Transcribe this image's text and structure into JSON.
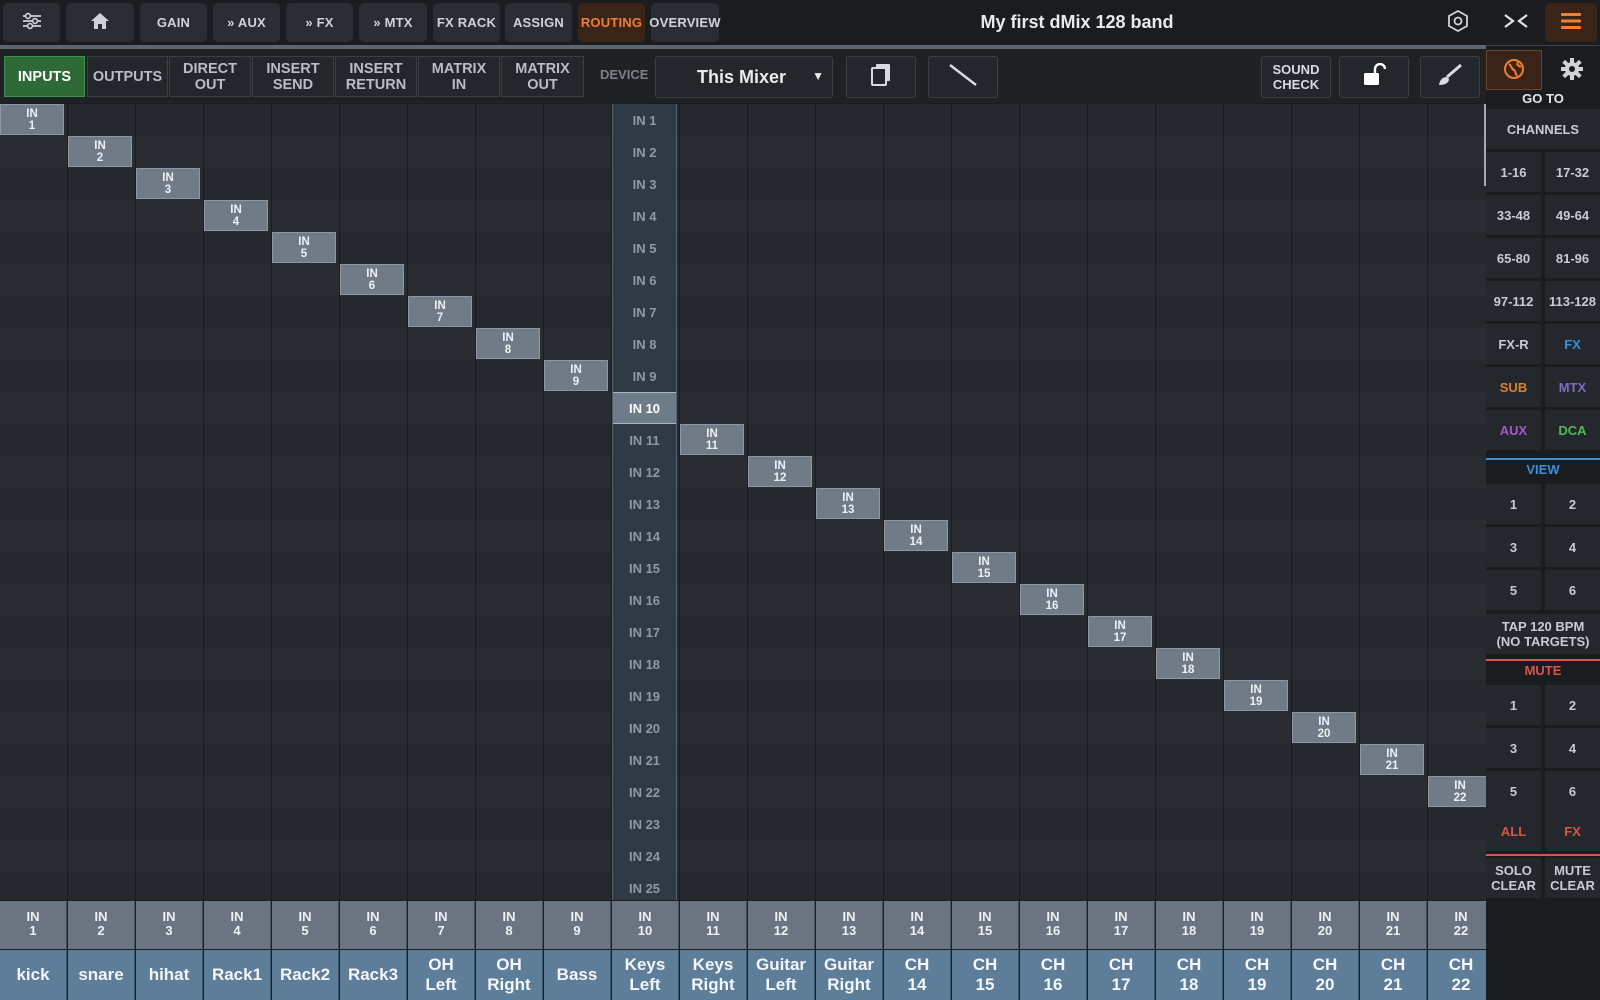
{
  "topbar": {
    "buttons": [
      {
        "id": "mixer",
        "label": "",
        "icon": "sliders-icon"
      },
      {
        "id": "home",
        "label": "",
        "icon": "home-icon"
      },
      {
        "id": "gain",
        "label": "GAIN"
      },
      {
        "id": "aux",
        "label": "» AUX"
      },
      {
        "id": "fx",
        "label": "» FX"
      },
      {
        "id": "mtx",
        "label": "» MTX"
      },
      {
        "id": "fxrack",
        "label": "FX RACK"
      },
      {
        "id": "assign",
        "label": "ASSIGN"
      },
      {
        "id": "routing",
        "label": "ROUTING",
        "active": true
      },
      {
        "id": "overview",
        "label": "OVERVIEW"
      }
    ],
    "title": "My first dMix 128 band"
  },
  "toolbar": {
    "tabs": [
      {
        "label": "INPUTS",
        "active": true
      },
      {
        "label": "OUTPUTS"
      },
      {
        "label": "DIRECT\nOUT"
      },
      {
        "label": "INSERT\nSEND"
      },
      {
        "label": "INSERT\nRETURN"
      },
      {
        "label": "MATRIX\nIN"
      },
      {
        "label": "MATRIX\nOUT"
      }
    ],
    "device_label": "DEVICE",
    "device_value": "This Mixer",
    "soundcheck": "SOUND\nCHECK"
  },
  "sources": [
    "IN 1",
    "IN 2",
    "IN 3",
    "IN 4",
    "IN 5",
    "IN 6",
    "IN 7",
    "IN 8",
    "IN 9",
    "IN 10",
    "IN 11",
    "IN 12",
    "IN 13",
    "IN 14",
    "IN 15",
    "IN 16",
    "IN 17",
    "IN 18",
    "IN 19",
    "IN 20",
    "IN 21",
    "IN 22",
    "IN 23",
    "IN 24",
    "IN 25"
  ],
  "selected_source": "IN 10",
  "channels": [
    {
      "num": "IN\n1",
      "name": "kick",
      "patch": "IN\n1"
    },
    {
      "num": "IN\n2",
      "name": "snare",
      "patch": "IN\n2"
    },
    {
      "num": "IN\n3",
      "name": "hihat",
      "patch": "IN\n3"
    },
    {
      "num": "IN\n4",
      "name": "Rack1",
      "patch": "IN\n4"
    },
    {
      "num": "IN\n5",
      "name": "Rack2",
      "patch": "IN\n5"
    },
    {
      "num": "IN\n6",
      "name": "Rack3",
      "patch": "IN\n6"
    },
    {
      "num": "IN\n7",
      "name": "OH\nLeft",
      "patch": "IN\n7"
    },
    {
      "num": "IN\n8",
      "name": "OH\nRight",
      "patch": "IN\n8"
    },
    {
      "num": "IN\n9",
      "name": "Bass",
      "patch": "IN\n9"
    },
    {
      "num": "IN\n10",
      "name": "Keys\nLeft",
      "patch": ""
    },
    {
      "num": "IN\n11",
      "name": "Keys\nRight",
      "patch": "IN\n11"
    },
    {
      "num": "IN\n12",
      "name": "Guitar\nLeft",
      "patch": "IN\n12"
    },
    {
      "num": "IN\n13",
      "name": "Guitar\nRight",
      "patch": "IN\n13"
    },
    {
      "num": "IN\n14",
      "name": "CH\n14",
      "patch": "IN\n14"
    },
    {
      "num": "IN\n15",
      "name": "CH\n15",
      "patch": "IN\n15"
    },
    {
      "num": "IN\n16",
      "name": "CH\n16",
      "patch": "IN\n16"
    },
    {
      "num": "IN\n17",
      "name": "CH\n17",
      "patch": "IN\n17"
    },
    {
      "num": "IN\n18",
      "name": "CH\n18",
      "patch": "IN\n18"
    },
    {
      "num": "IN\n19",
      "name": "CH\n19",
      "patch": "IN\n19"
    },
    {
      "num": "IN\n20",
      "name": "CH\n20",
      "patch": "IN\n20"
    },
    {
      "num": "IN\n21",
      "name": "CH\n21",
      "patch": "IN\n21"
    },
    {
      "num": "IN\n22",
      "name": "CH\n22",
      "patch": "IN\n22"
    }
  ],
  "sidebar": {
    "goto": "GO TO",
    "channels": "CHANNELS",
    "ranges": [
      "1-16",
      "17-32",
      "33-48",
      "49-64",
      "65-80",
      "81-96",
      "97-112",
      "113-128"
    ],
    "groups": [
      {
        "label": "FX-R",
        "color": "#c8ccd1"
      },
      {
        "label": "FX",
        "color": "#3d8fd6"
      },
      {
        "label": "SUB",
        "color": "#d9822b"
      },
      {
        "label": "MTX",
        "color": "#7d6cc6"
      },
      {
        "label": "AUX",
        "color": "#a45bc8"
      },
      {
        "label": "DCA",
        "color": "#4fb85c"
      }
    ],
    "view": "VIEW",
    "view_buttons": [
      "1",
      "2",
      "3",
      "4",
      "5",
      "6"
    ],
    "tap": "TAP 120 BPM\n(NO TARGETS)",
    "mute": "MUTE",
    "mute_buttons": [
      "1",
      "2",
      "3",
      "4",
      "5",
      "6"
    ],
    "mute_all": "ALL",
    "mute_fx": "FX",
    "solo_clear": "SOLO\nCLEAR",
    "mute_clear": "MUTE\nCLEAR"
  },
  "colors": {
    "accent": "#f07f32",
    "inputs_active": "#2d6a38",
    "view": "#3d8fd6",
    "mute": "#d9534f"
  }
}
